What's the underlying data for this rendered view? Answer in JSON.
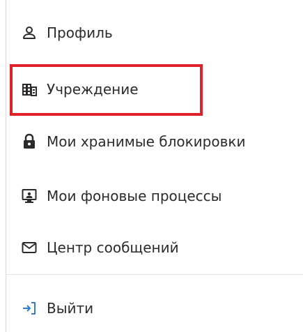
{
  "menu": {
    "items": [
      {
        "label": "Профиль",
        "icon": "user-icon"
      },
      {
        "label": "Учреждение",
        "icon": "building-icon"
      },
      {
        "label": "Мои хранимые блокировки",
        "icon": "lock-icon"
      },
      {
        "label": "Мои фоновые процессы",
        "icon": "monitor-icon"
      },
      {
        "label": "Центр сообщений",
        "icon": "envelope-icon"
      }
    ],
    "logout": {
      "label": "Выйти",
      "icon": "logout-icon"
    }
  },
  "colors": {
    "text": "#2b2b2b",
    "highlight": "#e0202a",
    "accent": "#2e7dd8"
  }
}
